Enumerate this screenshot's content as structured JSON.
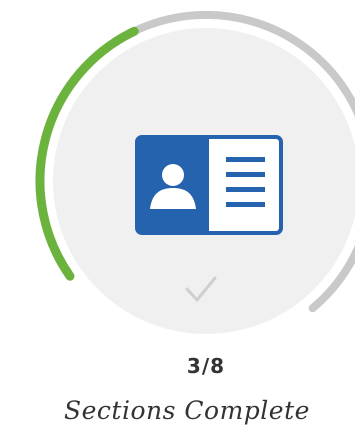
{
  "progress": {
    "completed": 3,
    "total": 8,
    "fraction": 0.375,
    "count_text": "3/8",
    "caption": "Sections Complete"
  },
  "icons": {
    "main": "id-card-icon",
    "check": "checkmark-icon"
  },
  "colors": {
    "progress": "#6cb33e",
    "track": "#c9c9c9",
    "inner_circle": "#f0f0f0",
    "card_blue": "#2563ae",
    "text": "#333333",
    "check": "#cfcfcf"
  }
}
